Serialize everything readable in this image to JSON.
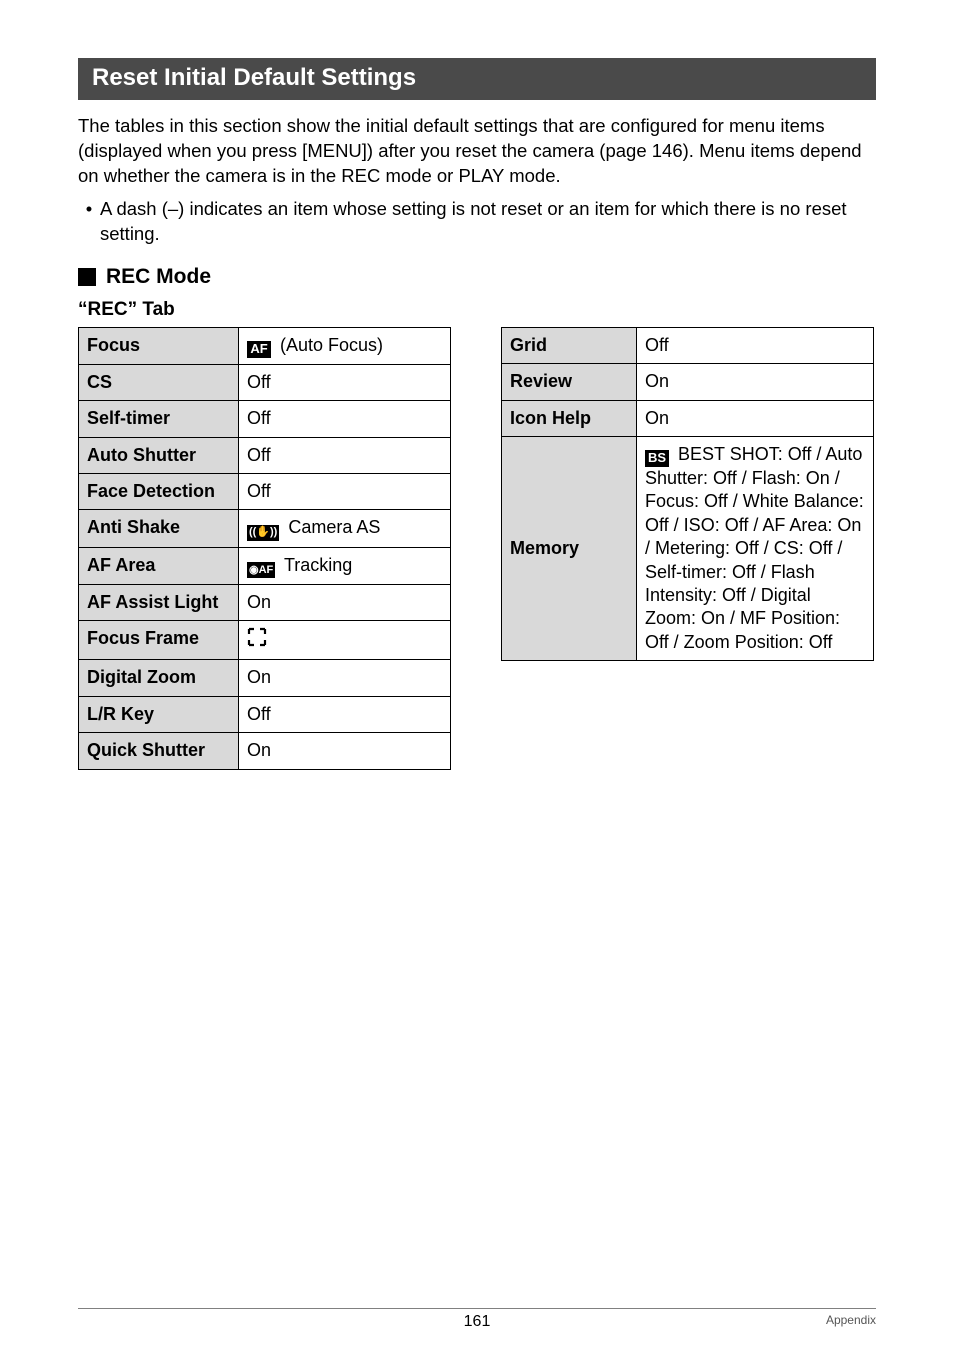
{
  "section_title": "Reset Initial Default Settings",
  "intro_text": "The tables in this section show the initial default settings that are configured for menu items (displayed when you press [MENU]) after you reset the camera (page 146). Menu items depend on whether the camera is in the REC mode or PLAY mode.",
  "bullet_text": "A dash (–) indicates an item whose setting is not reset or an item for which there is no reset setting.",
  "rec_mode_heading": "REC Mode",
  "rec_tab_label": "“REC” Tab",
  "left_table": {
    "rows": [
      {
        "label": "Focus",
        "value_prefix_icon": "AF",
        "value_text": " (Auto Focus)"
      },
      {
        "label": "CS",
        "value_text": "Off"
      },
      {
        "label": "Self-timer",
        "value_text": "Off"
      },
      {
        "label": "Auto Shutter",
        "value_text": "Off"
      },
      {
        "label": "Face Detection",
        "value_text": "Off"
      },
      {
        "label": "Anti Shake",
        "value_prefix_icon": "((✋))",
        "value_text": " Camera AS"
      },
      {
        "label": "AF Area",
        "value_prefix_icon": "◉AF",
        "value_text": " Tracking"
      },
      {
        "label": "AF Assist Light",
        "value_text": "On"
      },
      {
        "label": "Focus Frame",
        "focus_frame_icon": true
      },
      {
        "label": "Digital Zoom",
        "value_text": "On"
      },
      {
        "label": "L/R Key",
        "value_text": "Off"
      },
      {
        "label": "Quick Shutter",
        "value_text": "On"
      }
    ]
  },
  "right_table": {
    "rows": [
      {
        "label": "Grid",
        "value_text": "Off"
      },
      {
        "label": "Review",
        "value_text": "On"
      },
      {
        "label": "Icon Help",
        "value_text": "On"
      },
      {
        "label": "Memory",
        "memory": true,
        "bs_icon": "BS",
        "bs_text": " BEST SHOT: Off / Auto Shutter: Off / Flash: On / Focus: Off / White Balance: Off / ISO: Off / AF Area: On / Metering: Off / CS: Off / Self-timer: Off / Flash Intensity: Off / Digital Zoom: On / MF Position: Off / Zoom Position: Off"
      }
    ]
  },
  "footer": {
    "page_number": "161",
    "appendix": "Appendix"
  }
}
